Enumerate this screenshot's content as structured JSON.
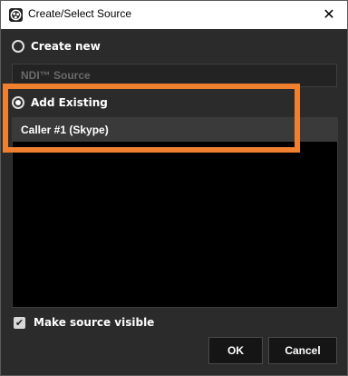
{
  "window": {
    "title": "Create/Select Source",
    "close_glyph": "✕",
    "app_icon": "obs-logo-icon"
  },
  "create_new": {
    "label": "Create new",
    "selected": false,
    "name_value": "NDI™ Source"
  },
  "add_existing": {
    "label": "Add Existing",
    "selected": true,
    "items": [
      {
        "label": "Caller #1 (Skype)",
        "selected": true
      }
    ]
  },
  "visibility": {
    "label": "Make source visible",
    "checked": true,
    "check_glyph": "✔"
  },
  "buttons": {
    "ok": "OK",
    "cancel": "Cancel"
  },
  "colors": {
    "highlight": "#ee8030",
    "background": "#2b2b2b"
  }
}
